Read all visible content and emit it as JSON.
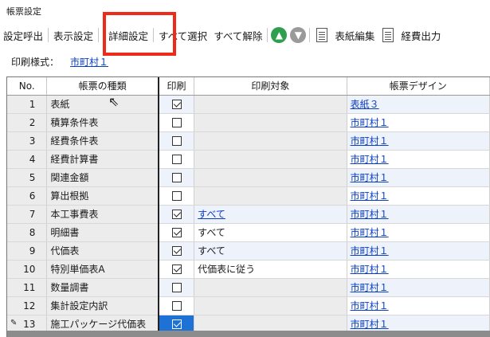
{
  "window": {
    "title": "帳票設定"
  },
  "toolbar": {
    "load_settings": "設定呼出",
    "display_settings": "表示設定",
    "detail_settings": "詳細設定",
    "select_all": "すべて選択",
    "deselect_all": "すべて解除",
    "cover_edit": "表紙編集",
    "expense_output": "経費出力"
  },
  "print_style": {
    "label": "印刷様式：",
    "value": "市町村１"
  },
  "grid": {
    "headers": {
      "no": "No.",
      "kind": "帳票の種類",
      "print": "印刷",
      "target": "印刷対象",
      "design": "帳票デザイン"
    },
    "rows": [
      {
        "no": "1",
        "kind": "表紙",
        "print": true,
        "target": "",
        "target_link": false,
        "design": "表紙３"
      },
      {
        "no": "2",
        "kind": "積算条件表",
        "print": false,
        "target": "",
        "target_link": false,
        "design": "市町村１"
      },
      {
        "no": "3",
        "kind": "経費条件表",
        "print": false,
        "target": "",
        "target_link": false,
        "design": "市町村１"
      },
      {
        "no": "4",
        "kind": "経費計算書",
        "print": false,
        "target": "",
        "target_link": false,
        "design": "市町村１"
      },
      {
        "no": "5",
        "kind": "関連金額",
        "print": false,
        "target": "",
        "target_link": false,
        "design": "市町村１"
      },
      {
        "no": "6",
        "kind": "算出根拠",
        "print": false,
        "target": "",
        "target_link": false,
        "design": "市町村１"
      },
      {
        "no": "7",
        "kind": "本工事費表",
        "print": true,
        "target": "すべて",
        "target_link": true,
        "design": "市町村１"
      },
      {
        "no": "8",
        "kind": "明細書",
        "print": true,
        "target": "すべて",
        "target_link": false,
        "design": "市町村１"
      },
      {
        "no": "9",
        "kind": "代価表",
        "print": true,
        "target": "すべて",
        "target_link": false,
        "design": "市町村１"
      },
      {
        "no": "10",
        "kind": "特別単価表A",
        "print": true,
        "target": "代価表に従う",
        "target_link": false,
        "design": "市町村１"
      },
      {
        "no": "11",
        "kind": "数量調書",
        "print": false,
        "target": "",
        "target_link": false,
        "design": "市町村１"
      },
      {
        "no": "12",
        "kind": "集計設定内訳",
        "print": false,
        "target": "",
        "target_link": false,
        "design": "市町村１"
      },
      {
        "no": "13",
        "kind": "施工パッケージ代価表",
        "print": true,
        "target": "",
        "target_link": false,
        "design": "市町村１",
        "selected": true,
        "editing": true
      }
    ]
  },
  "colors": {
    "accent_link": "#0a3ec2",
    "highlight_box": "#ee2a1b",
    "selection": "#1e72d6",
    "arrow_up": "#2e9f4e",
    "arrow_down": "#9a9a9a"
  },
  "icons": {
    "up": "arrow-up-circle-icon",
    "down": "arrow-down-circle-icon",
    "document": "document-icon",
    "pencil": "pencil-icon",
    "cursor": "mouse-pointer-icon"
  }
}
